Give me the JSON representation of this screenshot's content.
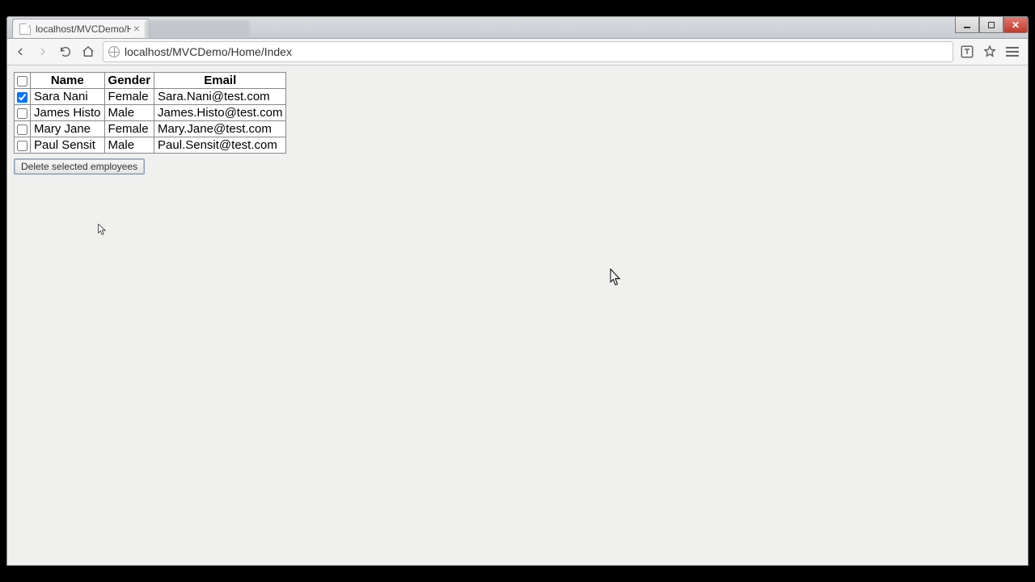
{
  "browser": {
    "tab_title": "localhost/MVCDemo/Hom",
    "url": "localhost/MVCDemo/Home/Index"
  },
  "table": {
    "headers": {
      "checkbox": "",
      "name": "Name",
      "gender": "Gender",
      "email": "Email"
    },
    "rows": [
      {
        "checked": true,
        "name": "Sara Nani",
        "gender": "Female",
        "email": "Sara.Nani@test.com"
      },
      {
        "checked": false,
        "name": "James Histo",
        "gender": "Male",
        "email": "James.Histo@test.com"
      },
      {
        "checked": false,
        "name": "Mary Jane",
        "gender": "Female",
        "email": "Mary.Jane@test.com"
      },
      {
        "checked": false,
        "name": "Paul Sensit",
        "gender": "Male",
        "email": "Paul.Sensit@test.com"
      }
    ]
  },
  "actions": {
    "delete_label": "Delete selected employees"
  }
}
